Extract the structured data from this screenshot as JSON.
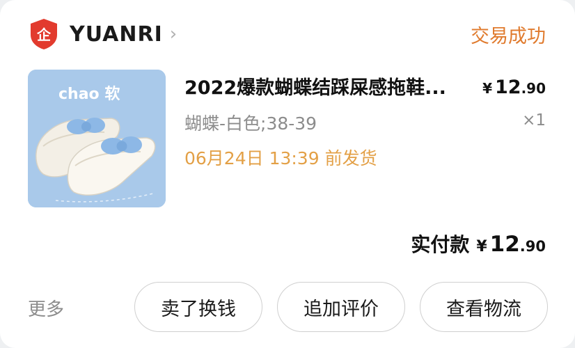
{
  "shop": {
    "name": "YUANRI",
    "logo_char": "企",
    "logo_color": "#e23b2e"
  },
  "order": {
    "status": "交易成功",
    "status_color": "#e07b2e"
  },
  "item": {
    "thumb_caption": "chao 软",
    "title": "2022爆款蝴蝶结踩屎感拖鞋...",
    "price": {
      "currency": "¥",
      "integer": "12",
      "decimal": ".90"
    },
    "variant": "蝴蝶-白色;38-39",
    "quantity": "×1",
    "ship_time": "06月24日 13:39 前发货",
    "ship_color": "#e3a046"
  },
  "total": {
    "label": "实付款",
    "currency": "¥",
    "integer": "12",
    "decimal": ".90"
  },
  "actions": {
    "more": "更多",
    "buttons": [
      "卖了换钱",
      "追加评价",
      "查看物流"
    ]
  }
}
